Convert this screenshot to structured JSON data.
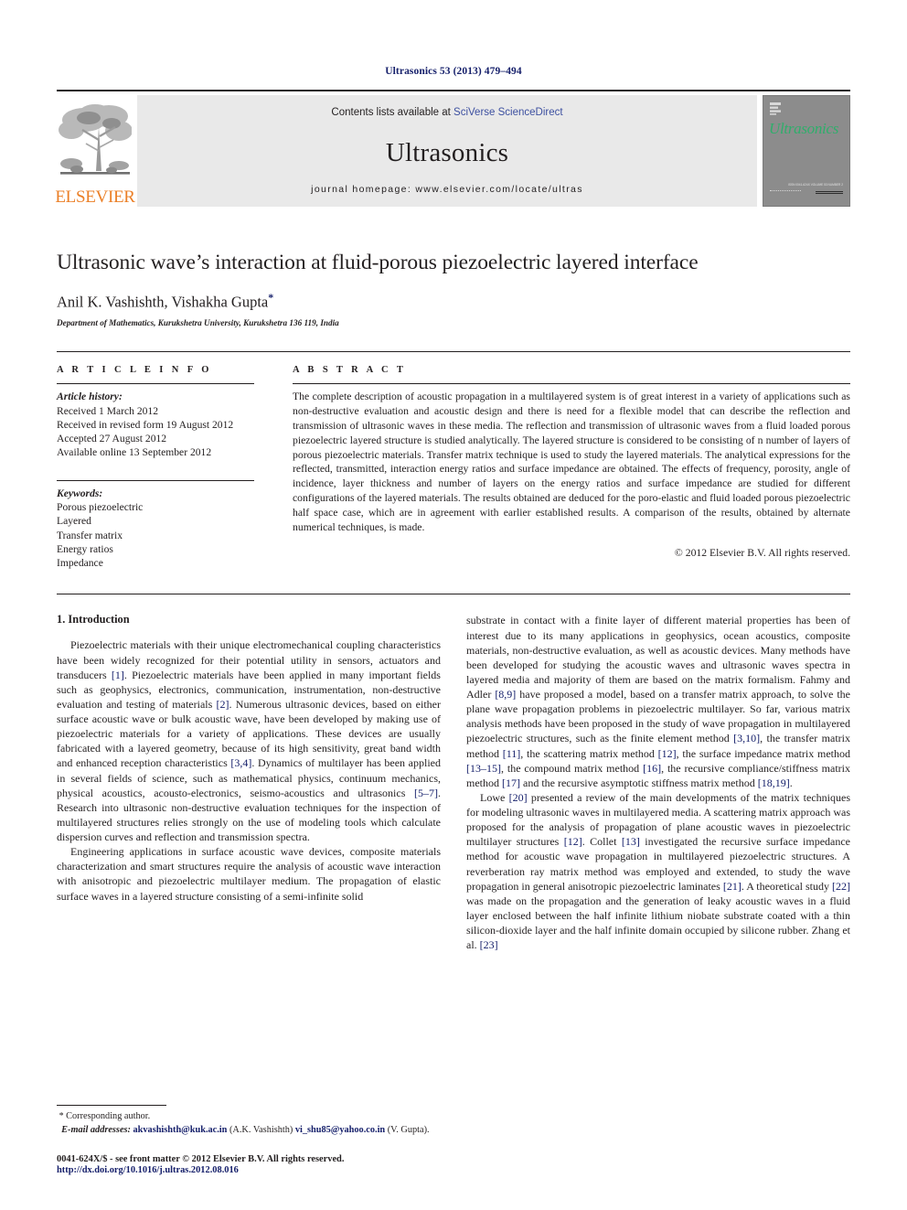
{
  "running_head": "Ultrasonics 53 (2013) 479–494",
  "banner": {
    "contents_prefix": "Contents lists available at ",
    "sciverse_link": "SciVerse ScienceDirect",
    "journal_name": "Ultrasonics",
    "homepage": "journal homepage: www.elsevier.com/locate/ultras",
    "publisher_wordmark": "ELSEVIER",
    "cover_title": "Ultrasonics",
    "cover_tiny_text": "ISSN 0041-624X   VOLUME 53  NUMBER 2",
    "accent_orange": "#eb7f26",
    "accent_green": "#2fae6b",
    "link_blue": "#3d50a0",
    "banner_grey": "#e9e9e9",
    "cover_grey": "#8c8c8c"
  },
  "article": {
    "title": "Ultrasonic wave’s interaction at fluid-porous piezoelectric layered interface",
    "authors": "Anil K. Vashishth, Vishakha Gupta",
    "corresponding_marker": "*",
    "affiliation": "Department of Mathematics, Kurukshetra University, Kurukshetra 136 119, India"
  },
  "article_info": {
    "heading": "A R T I C L E    I N F O",
    "history_label": "Article history:",
    "history": [
      "Received 1 March 2012",
      "Received in revised form 19 August 2012",
      "Accepted 27 August 2012",
      "Available online 13 September 2012"
    ],
    "keywords_label": "Keywords:",
    "keywords": [
      "Porous piezoelectric",
      "Layered",
      "Transfer matrix",
      "Energy ratios",
      "Impedance"
    ]
  },
  "abstract": {
    "heading": "A B S T R A C T",
    "text": "The complete description of acoustic propagation in a multilayered system is of great interest in a variety of applications such as non-destructive evaluation and acoustic design and there is need for a flexible model that can describe the reflection and transmission of ultrasonic waves in these media. The reflection and transmission of ultrasonic waves from a fluid loaded porous piezoelectric layered structure is studied analytically. The layered structure is considered to be consisting of n number of layers of porous piezoelectric materials. Transfer matrix technique is used to study the layered materials. The analytical expressions for the reflected, transmitted, interaction energy ratios and surface impedance are obtained. The effects of frequency, porosity, angle of incidence, layer thickness and number of layers on the energy ratios and surface impedance are studied for different configurations of the layered materials. The results obtained are deduced for the poro-elastic and fluid loaded porous piezoelectric half space case, which are in agreement with earlier established results. A comparison of the results, obtained by alternate numerical techniques, is made.",
    "copyright": "© 2012 Elsevier B.V. All rights reserved."
  },
  "introduction": {
    "heading": "1. Introduction",
    "left_paragraphs": [
      "Piezoelectric materials with their unique electromechanical coupling characteristics have been widely recognized for their potential utility in sensors, actuators and transducers [1]. Piezoelectric materials have been applied in many important fields such as geophysics, electronics, communication, instrumentation, non-destructive evaluation and testing of materials [2]. Numerous ultrasonic devices, based on either surface acoustic wave or bulk acoustic wave, have been developed by making use of piezoelectric materials for a variety of applications. These devices are usually fabricated with a layered geometry, because of its high sensitivity, great band width and enhanced reception characteristics [3,4]. Dynamics of multilayer has been applied in several fields of science, such as mathematical physics, continuum mechanics, physical acoustics, acousto-electronics, seismo-acoustics and ultrasonics [5–7]. Research into ultrasonic non-destructive evaluation techniques for the inspection of multilayered structures relies strongly on the use of modeling tools which calculate dispersion curves and reflection and transmission spectra.",
      "Engineering applications in surface acoustic wave devices, composite materials characterization and smart structures require the analysis of acoustic wave interaction with anisotropic and piezoelectric multilayer medium. The propagation of elastic surface waves in a layered structure consisting of a semi-infinite solid"
    ],
    "right_paragraphs": [
      "substrate in contact with a finite layer of different material properties has been of interest due to its many applications in geophysics, ocean acoustics, composite materials, non-destructive evaluation, as well as acoustic devices. Many methods have been developed for studying the acoustic waves and ultrasonic waves spectra in layered media and majority of them are based on the matrix formalism. Fahmy and Adler [8,9] have proposed a model, based on a transfer matrix approach, to solve the plane wave propagation problems in piezoelectric multilayer. So far, various matrix analysis methods have been proposed in the study of wave propagation in multilayered piezoelectric structures, such as the finite element method [3,10], the transfer matrix method [11], the scattering matrix method [12], the surface impedance matrix method [13–15], the compound matrix method [16], the recursive compliance/stiffness matrix method [17] and the recursive asymptotic stiffness matrix method [18,19].",
      "Lowe [20] presented a review of the main developments of the matrix techniques for modeling ultrasonic waves in multilayered media. A scattering matrix approach was proposed for the analysis of propagation of plane acoustic waves in piezoelectric multilayer structures [12]. Collet [13] investigated the recursive surface impedance method for acoustic wave propagation in multilayered piezoelectric structures. A reverberation ray matrix method was employed and extended, to study the wave propagation in general anisotropic piezoelectric laminates [21]. A theoretical study [22] was made on the propagation and the generation of leaky acoustic waves in a fluid layer enclosed between the half infinite lithium niobate substrate coated with a thin silicon-dioxide layer and the half infinite domain occupied by silicone rubber. Zhang et al. [23]"
    ]
  },
  "footnotes": {
    "corresponding_star": "*",
    "corresponding_label": "Corresponding author.",
    "email_label": "E-mail addresses:",
    "email_1": "akvashishth@kuk.ac.in",
    "email_1_owner": "(A.K. Vashishth)",
    "email_2": "vi_shu85@yahoo.co.in",
    "email_2_owner": "(V. Gupta).",
    "issn_line": "0041-624X/$ - see front matter © 2012 Elsevier B.V. All rights reserved.",
    "doi_line": "http://dx.doi.org/10.1016/j.ultras.2012.08.016"
  }
}
